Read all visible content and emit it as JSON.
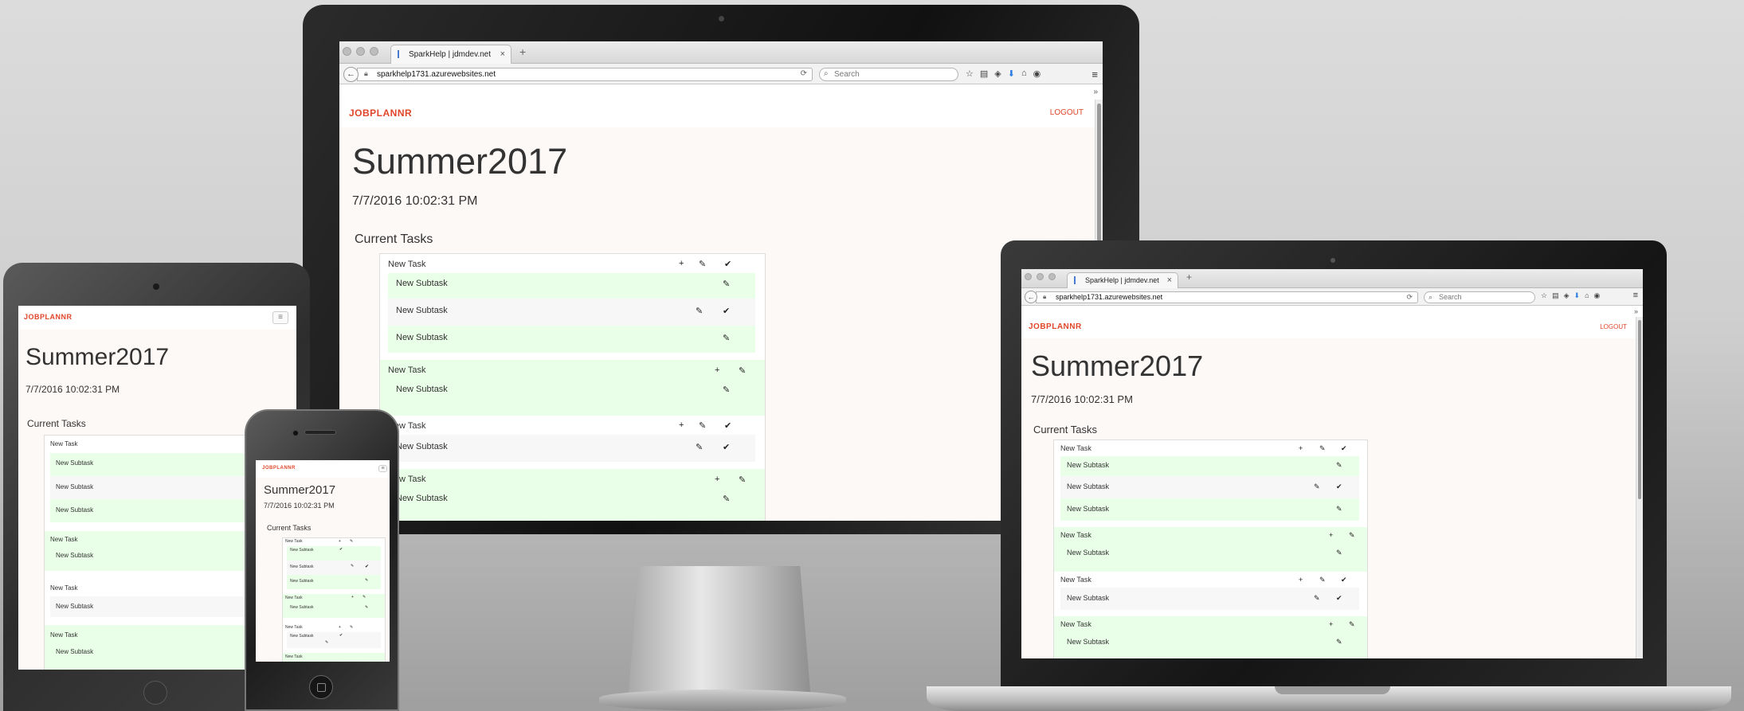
{
  "browser": {
    "tab_title": "SparkHelp | jdmdev.net",
    "tab_close": "×",
    "new_tab": "+",
    "back_glyph": "←",
    "url": "sparkhelp1731.azurewebsites.net",
    "search_placeholder": "Search",
    "menu_glyph": "≡",
    "overflow_glyph": "»",
    "reload_glyph": "⟳"
  },
  "app": {
    "brand": "JOBPLANNR",
    "logout": "LOGOUT",
    "title": "Summer2017",
    "timestamp": "7/7/2016 10:02:31 PM",
    "section": "Current Tasks",
    "task_label": "New Task",
    "subtask_label": "New Subtask",
    "add_glyph": "+",
    "edit_glyph": "✎",
    "done_glyph": "✔"
  },
  "colors": {
    "brand": "#e0462a",
    "subtask_bg": "#eaffe8",
    "page_bg": "#fdf9f7"
  },
  "icons": [
    "back-icon",
    "lock-icon",
    "reload-icon",
    "search-icon",
    "star-icon",
    "clipboard-icon",
    "pocket-icon",
    "download-icon",
    "home-icon",
    "chat-icon",
    "menu-icon",
    "add-icon",
    "edit-icon",
    "check-icon",
    "hamburger-icon"
  ]
}
